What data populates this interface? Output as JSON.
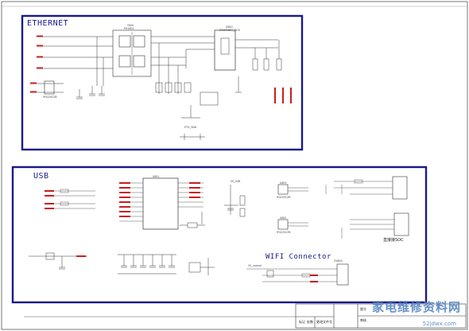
{
  "blocks": {
    "ethernet_title": "ETHERNET",
    "usb_title": "USB",
    "wifi_title": "WIFI Connector"
  },
  "ethernet": {
    "transformer_ref": "T800",
    "transformer_part": "PH1602",
    "rj45_ref": "JS801",
    "rj45_part": "ETHERNET_JACK",
    "tvs_part": "IP4220CZ6",
    "gnd": "ETH_GND"
  },
  "usb": {
    "hub_ref": "U801",
    "esd_ref_1": "U803",
    "esd_part_1": "IP4220CZ6",
    "esd_ref_2": "U802",
    "esd_part_2": "IP4220CZ6",
    "soc_note": "直接接SOC",
    "power_label": "5V_USB"
  },
  "wifi": {
    "connector_ref": "CN803",
    "power_label": "5V_normal"
  },
  "title_block": {
    "label_1": "标记",
    "label_2": "处数",
    "label_3": "更改文件号",
    "cell_a": "图号",
    "cell_b": "审核"
  },
  "watermark": {
    "text": "家电维修资料网",
    "url": "52jdwx.com"
  },
  "colors": {
    "frame": "#1a1a8a",
    "wire": "#333333",
    "net": "#c81e1e",
    "watermark": "#4a7cc0"
  }
}
